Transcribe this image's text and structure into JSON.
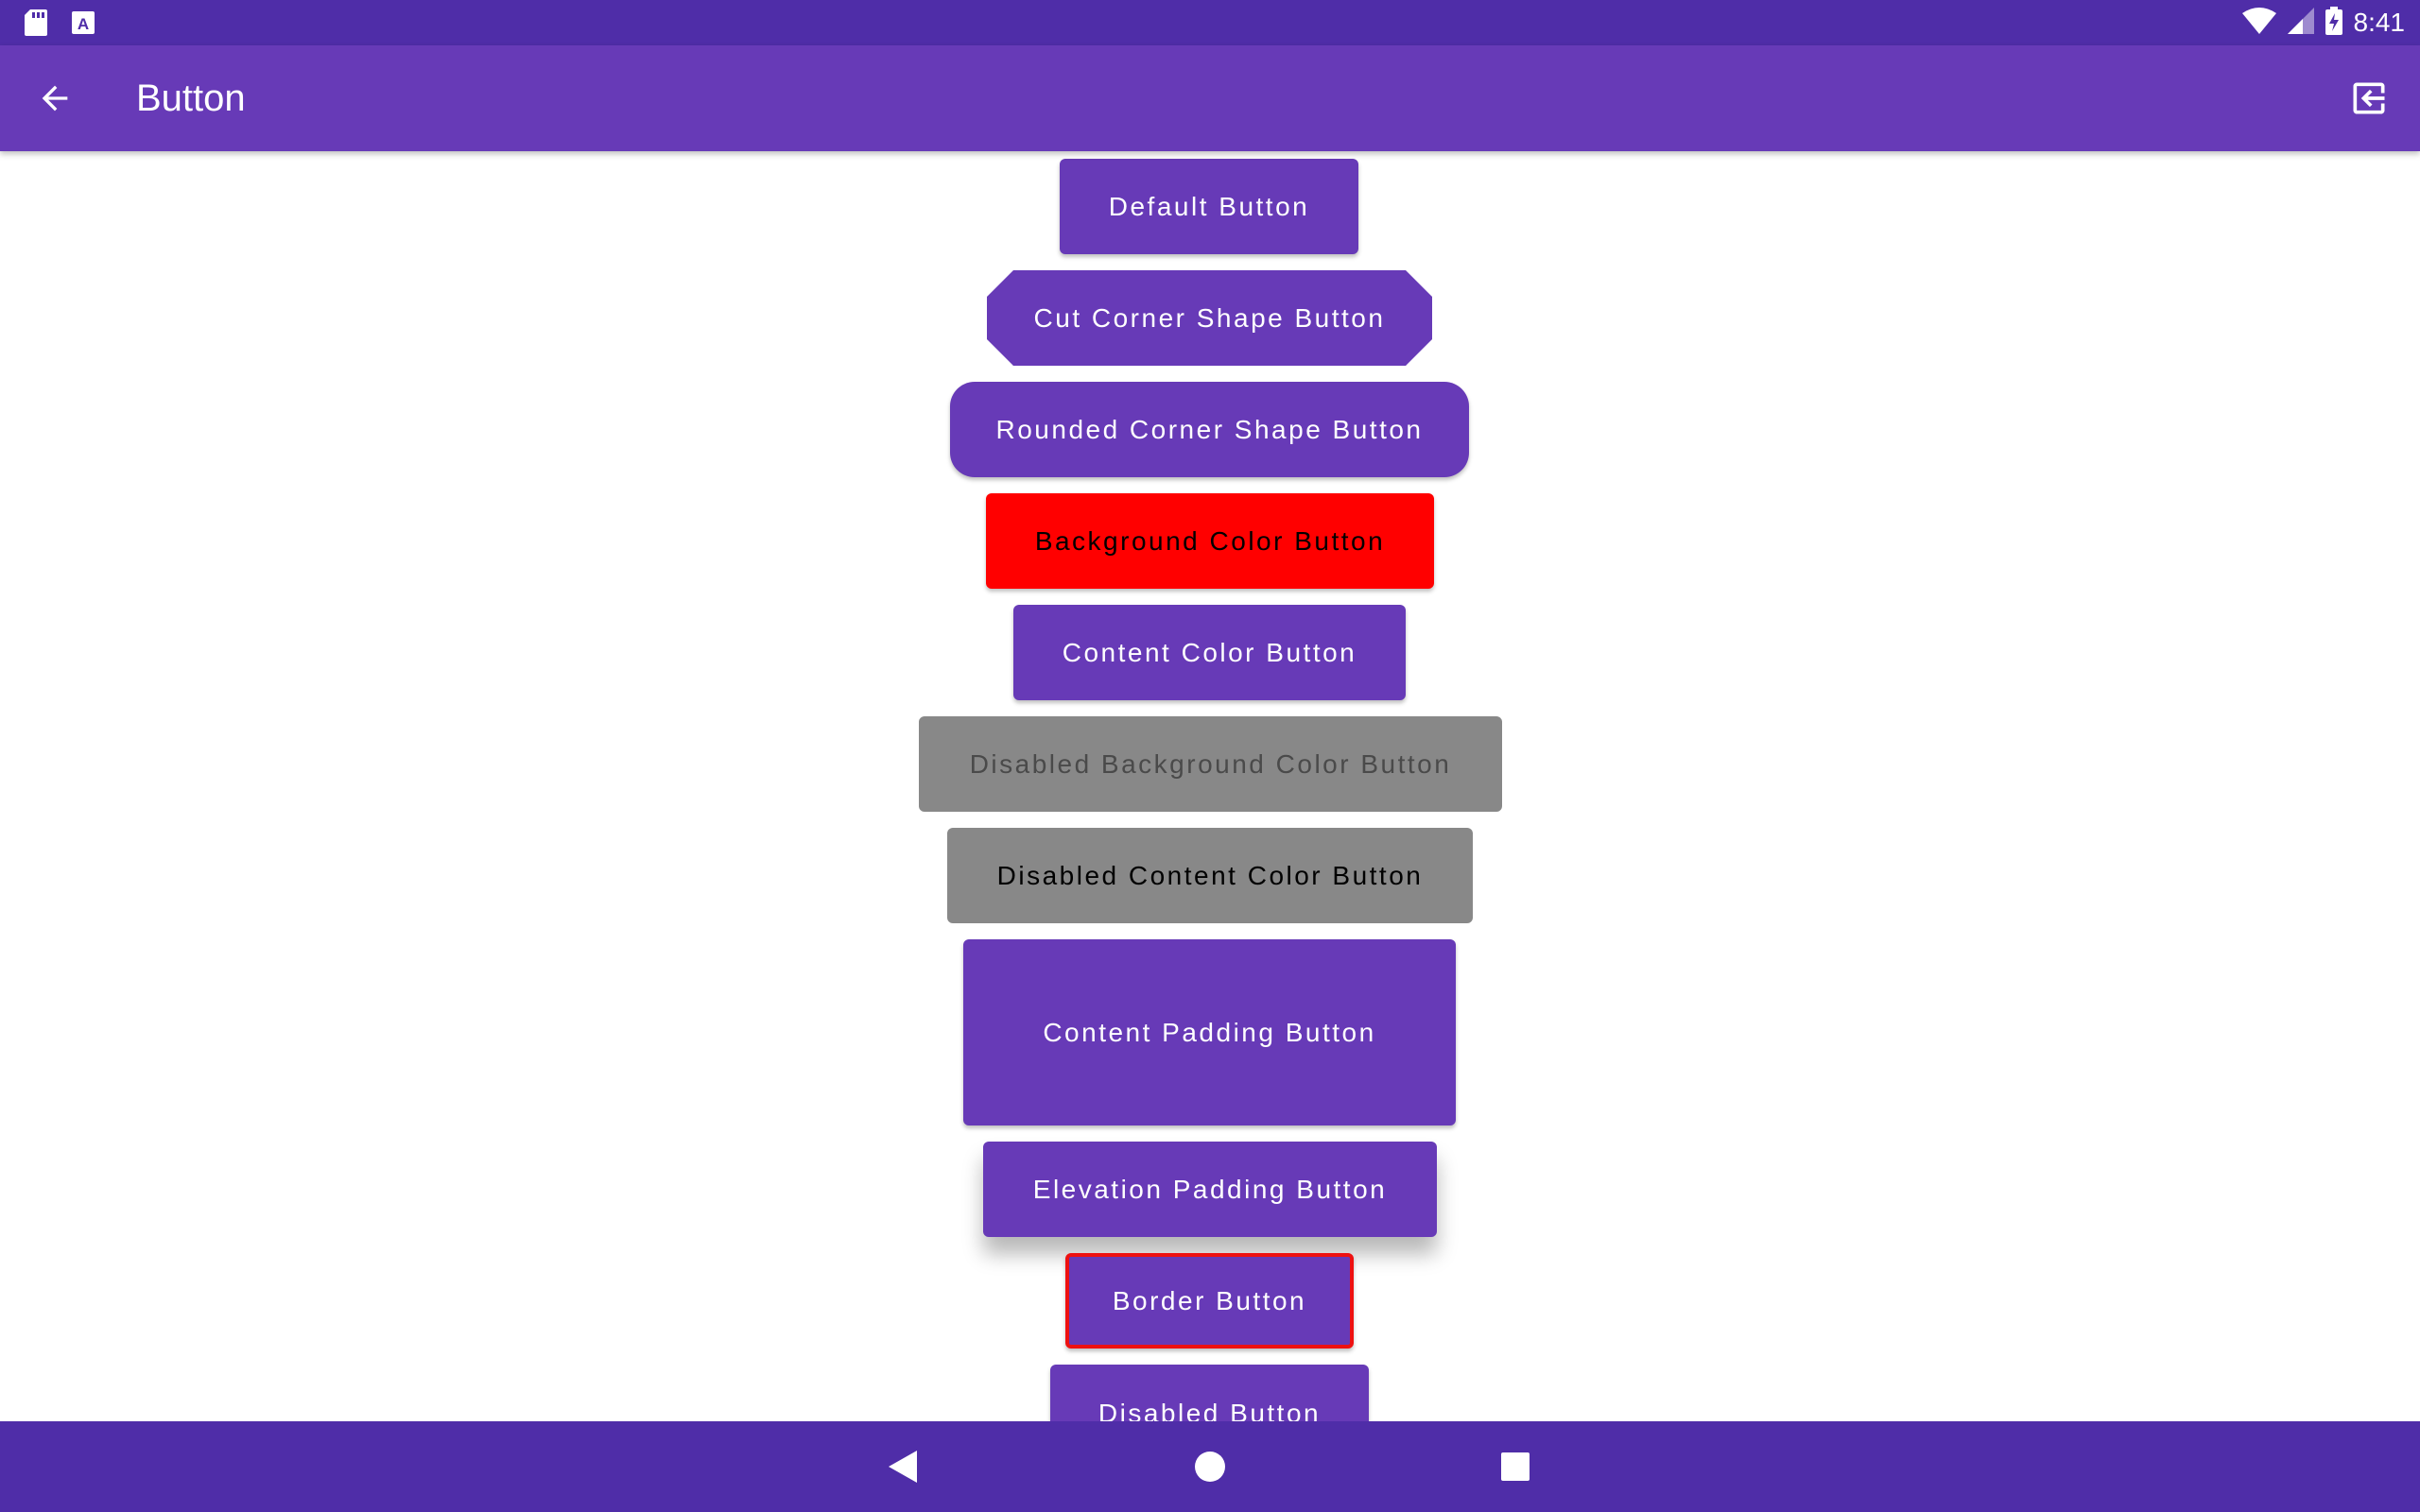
{
  "status_bar": {
    "time": "8:41",
    "left_icons": [
      "sd-card-icon",
      "a-badge-icon"
    ],
    "right_icons": [
      "wifi-icon",
      "cell-signal-icon",
      "battery-charging-icon"
    ]
  },
  "app_bar": {
    "title": "Button",
    "back_icon": "arrow-back-icon",
    "exit_icon": "exit-to-app-icon"
  },
  "buttons": [
    {
      "label": "Default Button",
      "bg": "#673ab7",
      "fg": "#ffffff"
    },
    {
      "label": "Cut Corner Shape Button",
      "bg": "#673ab7",
      "fg": "#ffffff"
    },
    {
      "label": "Rounded Corner Shape Button",
      "bg": "#673ab7",
      "fg": "#ffffff"
    },
    {
      "label": "Background Color Button",
      "bg": "#ff0000",
      "fg": "#000000"
    },
    {
      "label": "Content Color Button",
      "bg": "#673ab7",
      "fg": "#ffffff"
    },
    {
      "label": "Disabled Background Color Button",
      "bg": "#888888",
      "fg": "#4a4a4a"
    },
    {
      "label": "Disabled Content Color Button",
      "bg": "#888888",
      "fg": "#000000"
    },
    {
      "label": "Content Padding Button",
      "bg": "#673ab7",
      "fg": "#ffffff"
    },
    {
      "label": "Elevation Padding Button",
      "bg": "#673ab7",
      "fg": "#ffffff"
    },
    {
      "label": "Border Button",
      "bg": "#673ab7",
      "fg": "#ffffff",
      "border": "#ee1111"
    },
    {
      "label": "Disabled Button",
      "bg": "#673ab7",
      "fg": "#ffffff"
    }
  ],
  "nav_bar": {
    "icons": [
      "nav-back-icon",
      "nav-home-icon",
      "nav-recents-icon"
    ]
  },
  "colors": {
    "status_bar": "#4f2da8",
    "app_bar": "#673ab7",
    "nav_bar": "#4f2da8",
    "primary": "#673ab7"
  }
}
